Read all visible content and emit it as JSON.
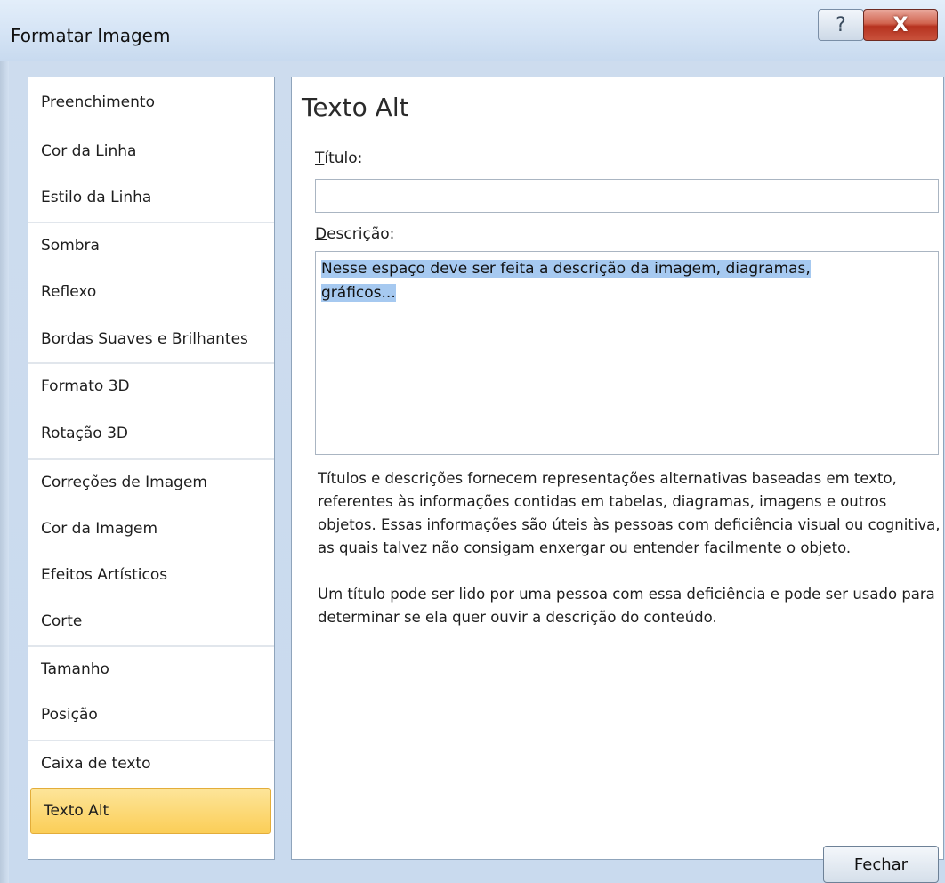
{
  "window": {
    "title": "Formatar Imagem",
    "help_icon": "?",
    "close_icon": "X"
  },
  "nav": {
    "items": [
      {
        "label": "Preenchimento"
      },
      {
        "label": "Cor da Linha"
      },
      {
        "label": "Estilo da Linha"
      },
      {
        "label": "Sombra"
      },
      {
        "label": "Reflexo"
      },
      {
        "label": "Bordas Suaves e Brilhantes"
      },
      {
        "label": "Formato 3D"
      },
      {
        "label": "Rotação 3D"
      },
      {
        "label": "Correções de Imagem"
      },
      {
        "label": "Cor da Imagem"
      },
      {
        "label": "Efeitos Artísticos"
      },
      {
        "label": "Corte"
      },
      {
        "label": "Tamanho"
      },
      {
        "label": "Posição"
      },
      {
        "label": "Caixa de texto"
      },
      {
        "label": "Texto Alt"
      }
    ],
    "selected": "Texto Alt"
  },
  "panel": {
    "heading": "Texto Alt",
    "title_label_first": "T",
    "title_label_rest": "ítulo:",
    "title_value": "",
    "desc_label_first": "D",
    "desc_label_rest": "escrição:",
    "desc_line1": "Nesse espaço deve ser feita a descrição da imagem, diagramas,",
    "desc_line2": "gráficos...",
    "help_paragraph1": "Títulos e descrições fornecem representações alternativas baseadas em texto, referentes às informações contidas em tabelas, diagramas, imagens e outros objetos. Essas informações são úteis às pessoas com deficiência visual ou cognitiva, as quais talvez não consigam enxergar ou entender facilmente o objeto.",
    "help_paragraph2": "Um título pode ser lido por uma pessoa com essa deficiência e pode ser usado para determinar se ela quer ouvir a descrição do conteúdo."
  },
  "footer": {
    "close_label": "Fechar"
  },
  "colors": {
    "selected_item_bg": "#fbce57",
    "selection_highlight": "#a6c9f0",
    "close_button_red": "#c9523c"
  }
}
